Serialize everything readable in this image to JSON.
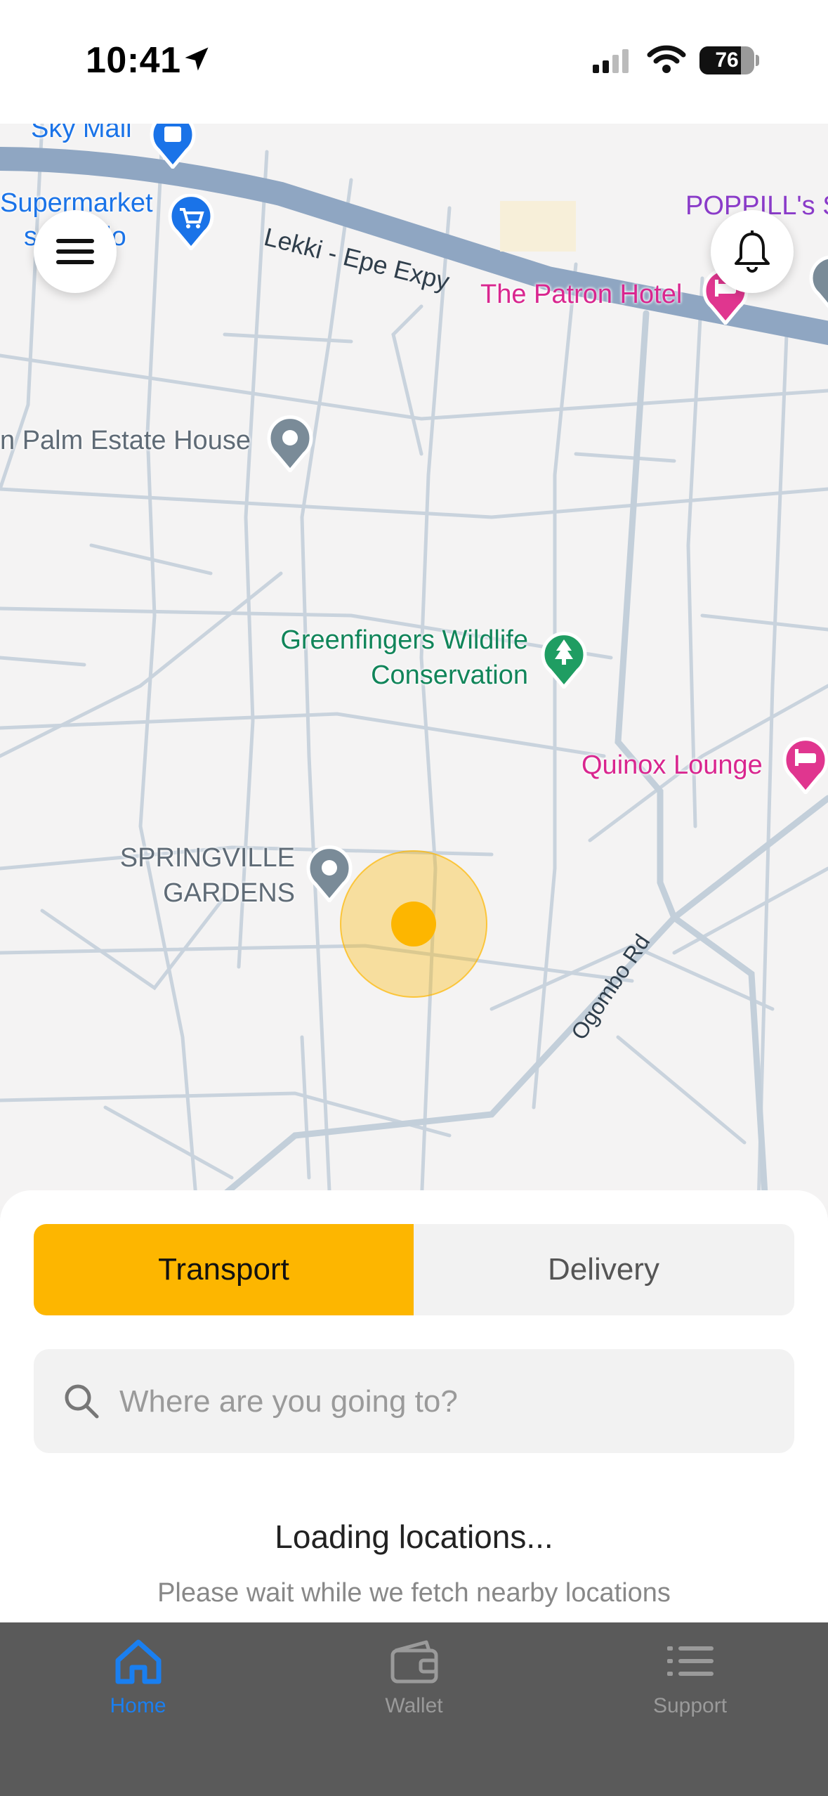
{
  "status_bar": {
    "time": "10:41",
    "battery_level": 76,
    "battery_text": "76"
  },
  "map": {
    "labels": {
      "sky_mall": "Sky Mall",
      "supermarket_line1": "Supermarket",
      "supermarket_line2": "s      edo",
      "expressway": "Lekki - Epe Expy",
      "poppill": "POPPILL's S",
      "patron_hotel": "The Patron Hotel",
      "palm_estate": "n Palm Estate House",
      "greenfingers_line1": "Greenfingers Wildlife",
      "greenfingers_line2": "Conservation",
      "quinox": "Quinox Lounge",
      "springville_line1": "SPRINGVILLE",
      "springville_line2": "GARDENS",
      "ogombo": "Ogombo Rd"
    },
    "colors": {
      "user_location": "#fdb600",
      "expressway": "#8fa6c2"
    }
  },
  "header": {
    "menu_icon": "hamburger-menu-icon",
    "bell_icon": "bell-icon"
  },
  "sheet": {
    "tabs": [
      {
        "label": "Transport",
        "active": true
      },
      {
        "label": "Delivery",
        "active": false
      }
    ],
    "search": {
      "placeholder": "Where are you going to?",
      "value": ""
    },
    "loading_title": "Loading locations...",
    "loading_subtitle": "Please wait while we fetch nearby locations"
  },
  "tabbar": {
    "items": [
      {
        "label": "Home",
        "icon": "home-icon",
        "active": true
      },
      {
        "label": "Wallet",
        "icon": "wallet-icon",
        "active": false
      },
      {
        "label": "Support",
        "icon": "list-icon",
        "active": false
      }
    ],
    "accent": "#1a7ff0"
  }
}
